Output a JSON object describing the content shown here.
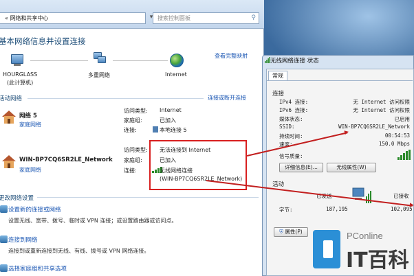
{
  "address": {
    "breadcrumb": "« 网络和共享中心",
    "search_placeholder": "搜索控制面板"
  },
  "main": {
    "title": "基本网络信息并设置连接",
    "full_map_link": "查看完整映射",
    "map": {
      "computer_name": "HOURGLASS",
      "computer_sub": "(此计算机)",
      "middle_label": "多重网络",
      "internet_label": "Internet"
    },
    "active_section": "活动网络",
    "connect_disconnect_link": "连接或断开连接",
    "networks": [
      {
        "name": "网络 5",
        "type_link": "家庭网络",
        "access_label": "访问类型:",
        "access_value": "Internet",
        "homegroup_label": "家庭组:",
        "homegroup_value": "已加入",
        "connection_label": "连接:",
        "connection_value": "本地连接 5"
      },
      {
        "name": "WIN-BP7CQ6SR2LE_Network",
        "type_link": "家庭网络",
        "access_label": "访问类型:",
        "access_value": "无法连接到 Internet",
        "homegroup_label": "家庭组:",
        "homegroup_value": "已加入",
        "connection_label": "连接:",
        "connection_value": "无线网络连接",
        "connection_value2": "(WIN-BP7CQ6SR2LE_Network)"
      }
    ],
    "change_section": "更改网络设置",
    "tasks": [
      {
        "title": "设置新的连接或网络",
        "desc": "设置无线、宽带、拨号、临时或 VPN 连接；或设置路由器或访问点。"
      },
      {
        "title": "连接到网络",
        "desc": "连接到或重新连接到无线、有线、拨号或 VPN 网络连接。"
      },
      {
        "title": "选择家庭组和共享选项",
        "desc": ""
      }
    ]
  },
  "status_dialog": {
    "title": "无线网络连接 状态",
    "tab": "常规",
    "connection_group": "连接",
    "rows": [
      {
        "label": "IPv4 连接:",
        "value": "无 Internet 访问权限"
      },
      {
        "label": "IPv6 连接:",
        "value": "无 Internet 访问权限"
      },
      {
        "label": "媒体状态:",
        "value": "已启用"
      },
      {
        "label": "SSID:",
        "value": "WIN-BP7CQ6SR2LE_Network"
      },
      {
        "label": "持续时间:",
        "value": "00:54:53"
      },
      {
        "label": "速度:",
        "value": "150.0 Mbps"
      }
    ],
    "signal_label": "信号质量:",
    "details_button": "详细信息(E)...",
    "wireless_props_button": "无线属性(W)",
    "activity_group": "活动",
    "sent_label": "已发送",
    "received_label": "已接收",
    "bytes_label": "字节:",
    "bytes_sent": "187,195",
    "bytes_received": "102,095",
    "properties_button": "属性(P)"
  },
  "watermark": {
    "site": "PConline",
    "brand": "IT百科"
  }
}
